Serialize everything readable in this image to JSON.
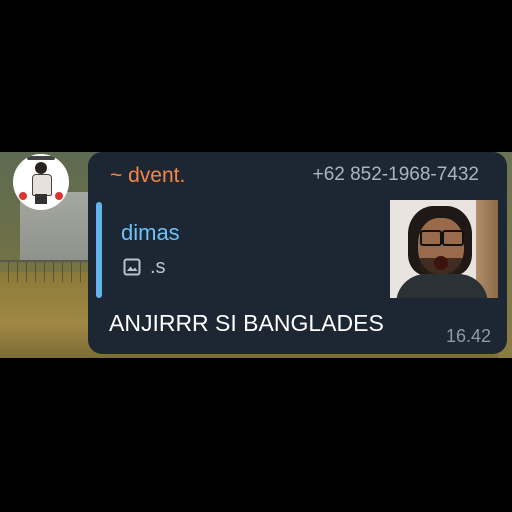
{
  "message": {
    "sender_name": "~ dvent.",
    "sender_phone": "+62 852-1968-7432",
    "reply": {
      "author": "dimas",
      "media_icon": "image-icon",
      "caption": ".s"
    },
    "text": "ANJIRRR SI BANGLADES",
    "time": "16.42"
  },
  "colors": {
    "bubble_bg": "#1d2733",
    "sender_name": "#f4864a",
    "reply_accent": "#64b5ef",
    "text": "#ffffff",
    "meta": "#8d99a6"
  }
}
